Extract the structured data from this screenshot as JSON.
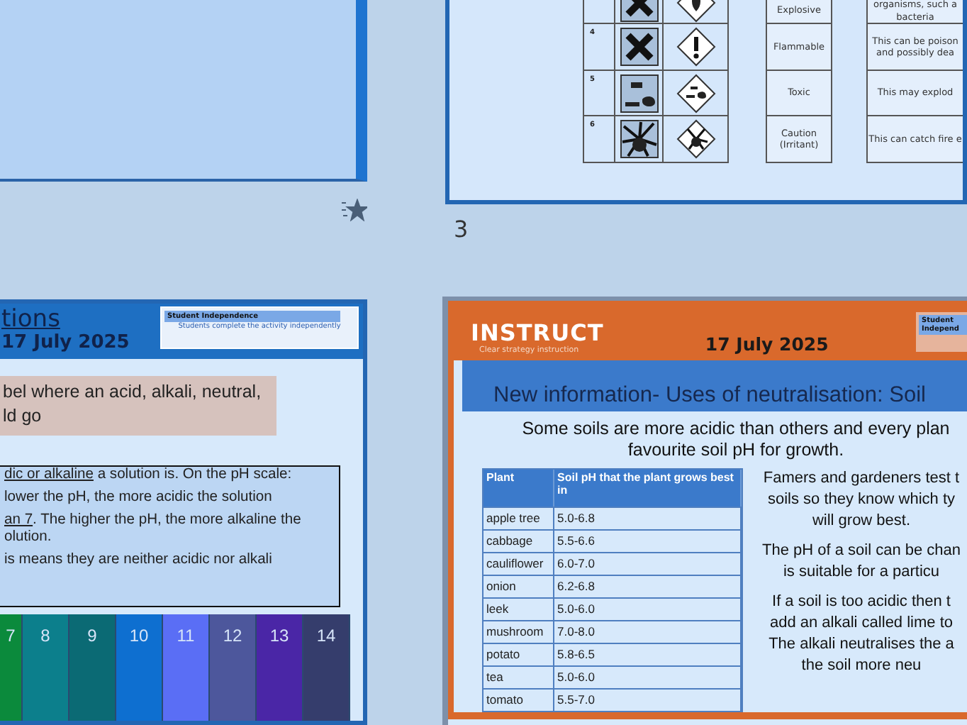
{
  "slides": [
    {
      "kind": "blank"
    },
    {
      "kind": "hazards",
      "number": "3",
      "rows": [
        {
          "number": "",
          "name": [
            "Explosive"
          ],
          "description": [
            "organisms, such a",
            "bacteria"
          ]
        },
        {
          "number": "4",
          "name": [
            "Flammable"
          ],
          "description": [
            "This can be poison",
            "and possibly dea"
          ]
        },
        {
          "number": "5",
          "name": [
            "Toxic"
          ],
          "description": [
            "This may explod"
          ]
        },
        {
          "number": "6",
          "name": [
            "Caution",
            "(Irritant)"
          ],
          "description": [
            "This can catch fire e"
          ]
        }
      ]
    },
    {
      "kind": "ph_scale",
      "title": "tions",
      "date": "17 July 2025",
      "badge": {
        "title": "Student Independence",
        "subtitle": "Students complete the activity independently"
      },
      "task": [
        "bel where an acid, alkali, neutral,",
        "ld go"
      ],
      "info": [
        [
          [
            {
              "text": "dic or alkaline",
              "underline": true
            },
            {
              "text": " a solution is.  On the pH scale:",
              "underline": false
            }
          ]
        ],
        [
          [
            {
              "text": "lower the pH, the more acidic the solution",
              "underline": false
            }
          ]
        ],
        [
          [
            {
              "text": "an 7",
              "underline": true
            },
            {
              "text": ".  The higher the pH, the more alkaline the",
              "underline": false
            }
          ],
          [
            {
              "text": "olution.",
              "underline": false
            }
          ]
        ],
        [
          [
            {
              "text": "is means they are neither acidic nor alkali",
              "underline": false
            }
          ]
        ]
      ],
      "scale": [
        {
          "value": "7",
          "color": "#0b8a3c"
        },
        {
          "value": "8",
          "color": "#0c7f8c"
        },
        {
          "value": "9",
          "color": "#0b6a74"
        },
        {
          "value": "10",
          "color": "#0e6fd0"
        },
        {
          "value": "11",
          "color": "#5a6ef5"
        },
        {
          "value": "12",
          "color": "#4d579c"
        },
        {
          "value": "13",
          "color": "#4a26a6"
        },
        {
          "value": "14",
          "color": "#353d6c"
        }
      ]
    },
    {
      "kind": "table",
      "heading": "INSTRUCT",
      "subheading": "Clear strategy instruction",
      "date": "17 July 2025",
      "badge": {
        "title": "Student Independ"
      },
      "title": "New information- Uses of neutralisation: Soil",
      "intro": [
        "Some soils are more acidic than others and every plan",
        "favourite soil pH for growth."
      ],
      "table": {
        "columns": [
          "Plant",
          "Soil pH that the plant grows best in"
        ],
        "rows": [
          [
            "apple tree",
            "5.0-6.8"
          ],
          [
            "cabbage",
            "5.5-6.6"
          ],
          [
            "cauliflower",
            "6.0-7.0"
          ],
          [
            "onion",
            "6.2-6.8"
          ],
          [
            "leek",
            "5.0-6.0"
          ],
          [
            "mushroom",
            "7.0-8.0"
          ],
          [
            "potato",
            "5.8-6.5"
          ],
          [
            "tea",
            "5.0-6.0"
          ],
          [
            "tomato",
            "5.5-7.0"
          ]
        ]
      },
      "paragraphs": [
        [
          "Famers and gardeners test t",
          "soils so they know which ty",
          "will grow best."
        ],
        [
          "The pH of a soil can be chan",
          "is suitable for a particu"
        ],
        [
          "If a soil is too acidic then t",
          "add an alkali called lime to",
          "The alkali neutralises the a",
          "the soil more neu"
        ]
      ]
    }
  ]
}
